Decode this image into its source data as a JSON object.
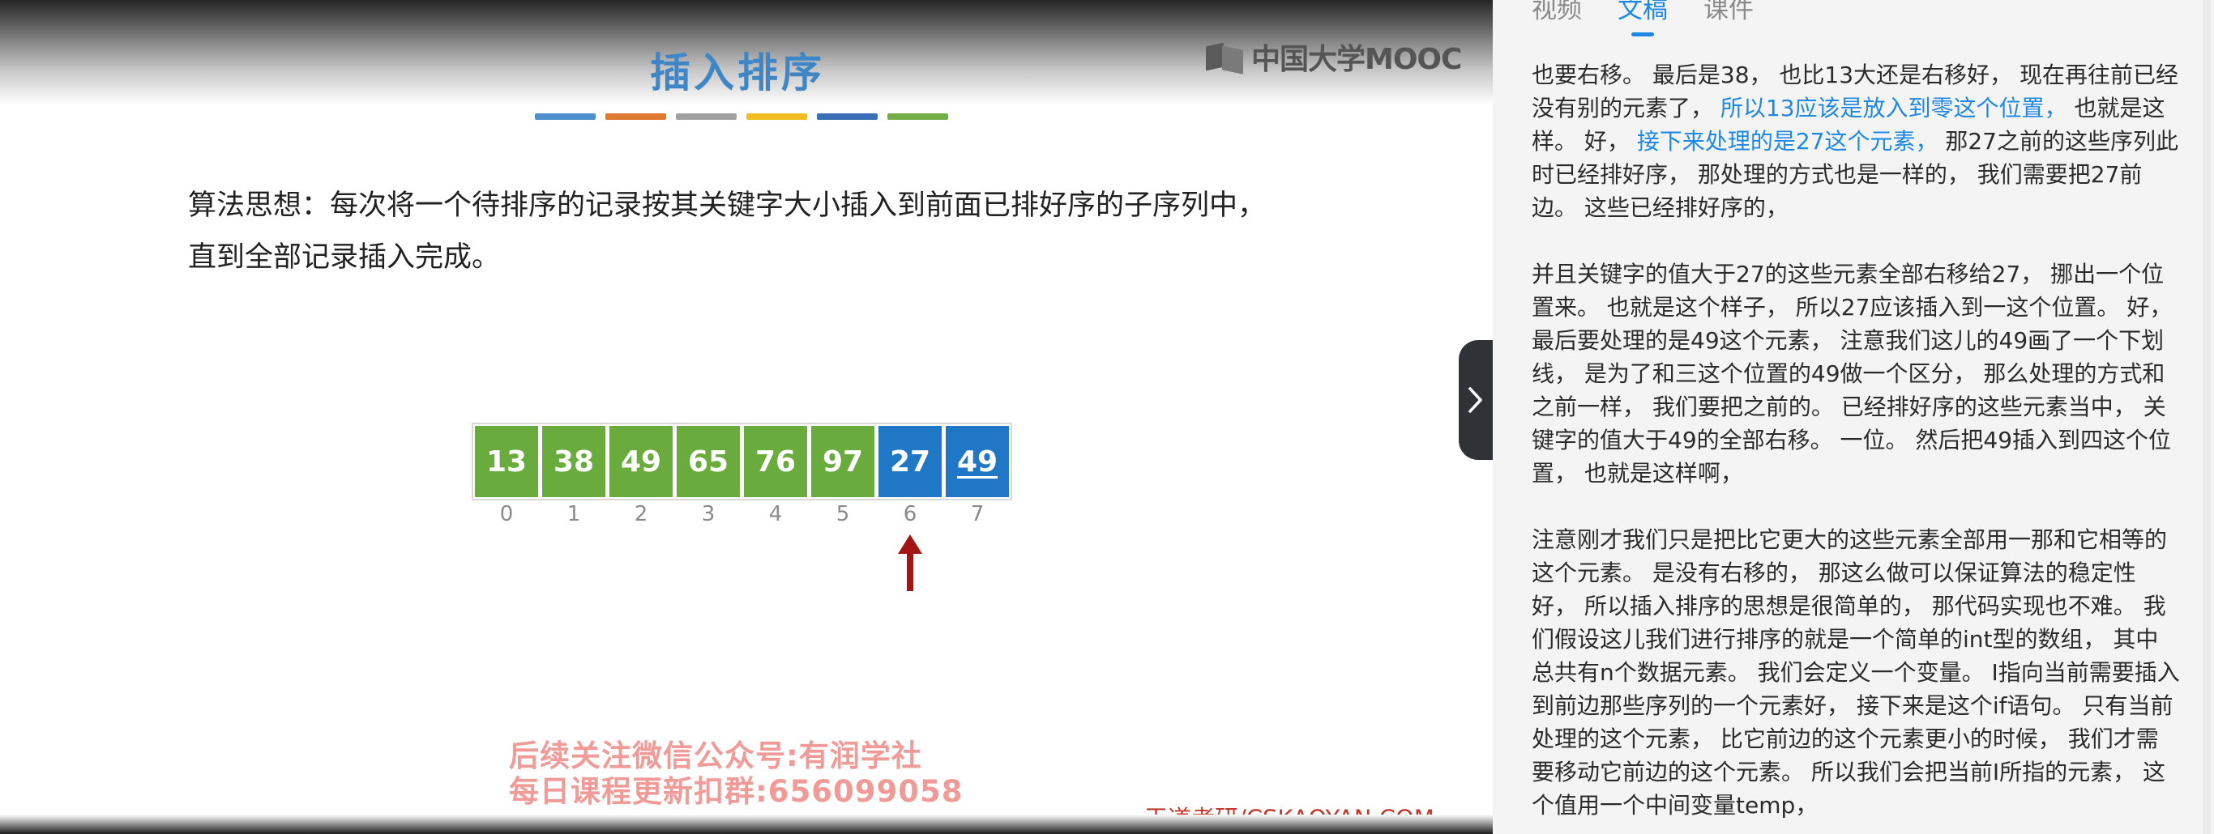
{
  "slide": {
    "title": "插入排序",
    "logo_text": "中国大学MOOC",
    "algorithm_line1": "算法思想：每次将一个待排序的记录按其关键字大小插入到前面已排好序的子序列中，",
    "algorithm_line2": "直到全部记录插入完成。",
    "bar_colors": [
      "#4f8fcf",
      "#e0782f",
      "#a0a0a0",
      "#f2bd1e",
      "#3a6fb8",
      "#74ad45"
    ],
    "array": [
      {
        "value": "13",
        "color": "green"
      },
      {
        "value": "38",
        "color": "green"
      },
      {
        "value": "49",
        "color": "green"
      },
      {
        "value": "65",
        "color": "green"
      },
      {
        "value": "76",
        "color": "green"
      },
      {
        "value": "97",
        "color": "green"
      },
      {
        "value": "27",
        "color": "blue"
      },
      {
        "value": "49",
        "color": "blue",
        "underline": true
      }
    ],
    "indices": [
      "0",
      "1",
      "2",
      "3",
      "4",
      "5",
      "6",
      "7"
    ],
    "pointer_index": 6,
    "watermark_line1": "后续关注微信公众号:有润学社",
    "watermark_line2": "每日课程更新扣群:656099058",
    "footer_brand": "王道考研/CSKAOYAN.COM"
  },
  "panel": {
    "tabs": [
      {
        "label": "视频",
        "active": false
      },
      {
        "label": "文稿",
        "active": true
      },
      {
        "label": "课件",
        "active": false
      }
    ],
    "p1": [
      {
        "t": "也要右移。 最后是38， 也比13大还是右移好， 现在再往前已经没有别的元素了， "
      },
      {
        "t": "所以13应该是放入到零这个位置，",
        "hl": true
      },
      {
        "t": " 也就是这样。 好， "
      },
      {
        "t": "接下来处理的是27这个元素，",
        "hl": true
      },
      {
        "t": " 那27之前的这些序列此时已经排好序， 那处理的方式也是一样的， 我们需要把27前边。 这些已经排好序的，"
      }
    ],
    "p2": "并且关键字的值大于27的这些元素全部右移给27， 挪出一个位置来。 也就是这个样子， 所以27应该插入到一这个位置。 好， 最后要处理的是49这个元素， 注意我们这儿的49画了一个下划线， 是为了和三这个位置的49做一个区分， 那么处理的方式和之前一样， 我们要把之前的。 已经排好序的这些元素当中， 关键字的值大于49的全部右移。 一位。 然后把49插入到四这个位置， 也就是这样啊，",
    "p3": "注意刚才我们只是把比它更大的这些元素全部用一那和它相等的这个元素。 是没有右移的， 那这么做可以保证算法的稳定性好， 所以插入排序的思想是很简单的， 那代码实现也不难。 我们假设这儿我们进行排序的就是一个简单的int型的数组， 其中总共有n个数据元素。 我们会定义一个变量。 I指向当前需要插入到前边那些序列的一个元素好， 接下来是这个if语句。 只有当前处理的这个元素， 比它前边的这个元素更小的时候， 我们才需要移动它前边的这个元素。 所以我们会把当前I所指的元素， 这个值用一个中间变量temp，"
  }
}
